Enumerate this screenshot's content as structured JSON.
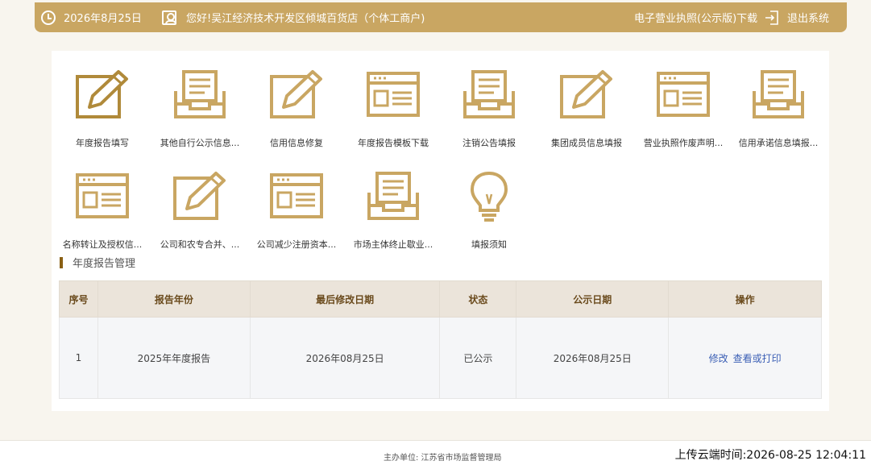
{
  "header": {
    "date": "2026年8月25日",
    "greeting": "您好!吴江经济技术开发区倾城百货店（个体工商户)",
    "license_download": "电子营业执照(公示版)下载",
    "logout": "退出系统",
    "accent_color": "#c9a662"
  },
  "tiles": [
    {
      "label": "年度报告填写",
      "icon": "edit-icon"
    },
    {
      "label": "其他自行公示信息...",
      "icon": "inbox-icon"
    },
    {
      "label": "信用信息修复",
      "icon": "edit-icon"
    },
    {
      "label": "年度报告模板下载",
      "icon": "form-icon"
    },
    {
      "label": "注销公告填报",
      "icon": "inbox-icon"
    },
    {
      "label": "集团成员信息填报",
      "icon": "edit-icon"
    },
    {
      "label": "营业执照作废声明...",
      "icon": "form-icon"
    },
    {
      "label": "信用承诺信息填报...",
      "icon": "inbox-icon"
    },
    {
      "label": "名称转让及授权信...",
      "icon": "form-icon"
    },
    {
      "label": "公司和农专合并、...",
      "icon": "edit-icon"
    },
    {
      "label": "公司减少注册资本...",
      "icon": "form-icon"
    },
    {
      "label": "市场主体终止歇业...",
      "icon": "inbox-icon"
    },
    {
      "label": "填报须知",
      "icon": "lightbulb-icon"
    }
  ],
  "report_section": {
    "title": "年度报告管理",
    "columns": [
      "序号",
      "报告年份",
      "最后修改日期",
      "状态",
      "公示日期",
      "操作"
    ],
    "rows": [
      {
        "index": "1",
        "year": "2025年年度报告",
        "modified": "2026年08月25日",
        "status": "已公示",
        "publish_date": "2026年08月25日",
        "action_edit": "修改",
        "action_view": "查看或打印"
      }
    ]
  },
  "footer": {
    "sponsor": "主办单位:  江苏省市场监督管理局",
    "sync_time": "上传云端时间:2026-08-25 12:04:11"
  }
}
